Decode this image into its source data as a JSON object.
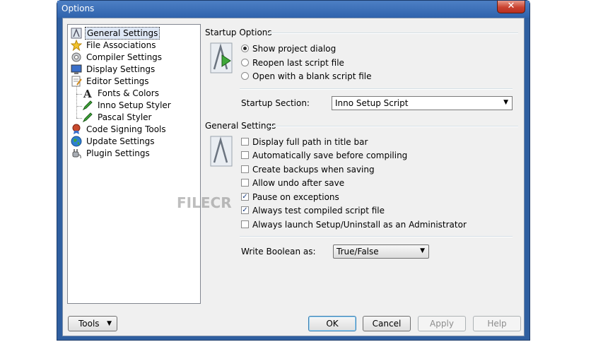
{
  "window": {
    "title": "Options",
    "close_glyph": "✕"
  },
  "tree": {
    "items": [
      {
        "label": "General Settings",
        "icon": "general-settings-icon",
        "selected": true
      },
      {
        "label": "File Associations",
        "icon": "star-icon"
      },
      {
        "label": "Compiler Settings",
        "icon": "gear-icon"
      },
      {
        "label": "Display Settings",
        "icon": "monitor-icon"
      },
      {
        "label": "Editor Settings",
        "icon": "editor-icon"
      },
      {
        "label": "Fonts & Colors",
        "icon": "font-icon"
      },
      {
        "label": "Inno Setup Styler",
        "icon": "pencil-icon"
      },
      {
        "label": "Pascal Styler",
        "icon": "pencil-icon"
      },
      {
        "label": "Code Signing Tools",
        "icon": "seal-icon"
      },
      {
        "label": "Update Settings",
        "icon": "globe-icon"
      },
      {
        "label": "Plugin Settings",
        "icon": "plug-icon"
      }
    ]
  },
  "startup": {
    "title": "Startup Options",
    "options": [
      {
        "label": "Show project dialog",
        "checked": true
      },
      {
        "label": "Reopen last script file",
        "checked": false
      },
      {
        "label": "Open with a blank script file",
        "checked": false
      }
    ],
    "section_label": "Startup Section:",
    "section_value": "Inno Setup Script"
  },
  "general": {
    "title": "General Settings",
    "checks": [
      {
        "label": "Display full path in title bar",
        "checked": false
      },
      {
        "label": "Automatically save before compiling",
        "checked": false
      },
      {
        "label": "Create backups when saving",
        "checked": false
      },
      {
        "label": "Allow undo after save",
        "checked": false
      },
      {
        "label": "Pause on exceptions",
        "checked": true
      },
      {
        "label": "Always test compiled script file",
        "checked": true
      },
      {
        "label": "Always launch Setup/Uninstall as an Administrator",
        "checked": false
      }
    ],
    "bool_label": "Write Boolean as:",
    "bool_value": "True/False"
  },
  "buttons": {
    "tools": "Tools",
    "ok": "OK",
    "cancel": "Cancel",
    "apply": "Apply",
    "help": "Help"
  },
  "watermark": "FILECR",
  "glyphs": {
    "dropdown": "▼",
    "check": "✓"
  }
}
